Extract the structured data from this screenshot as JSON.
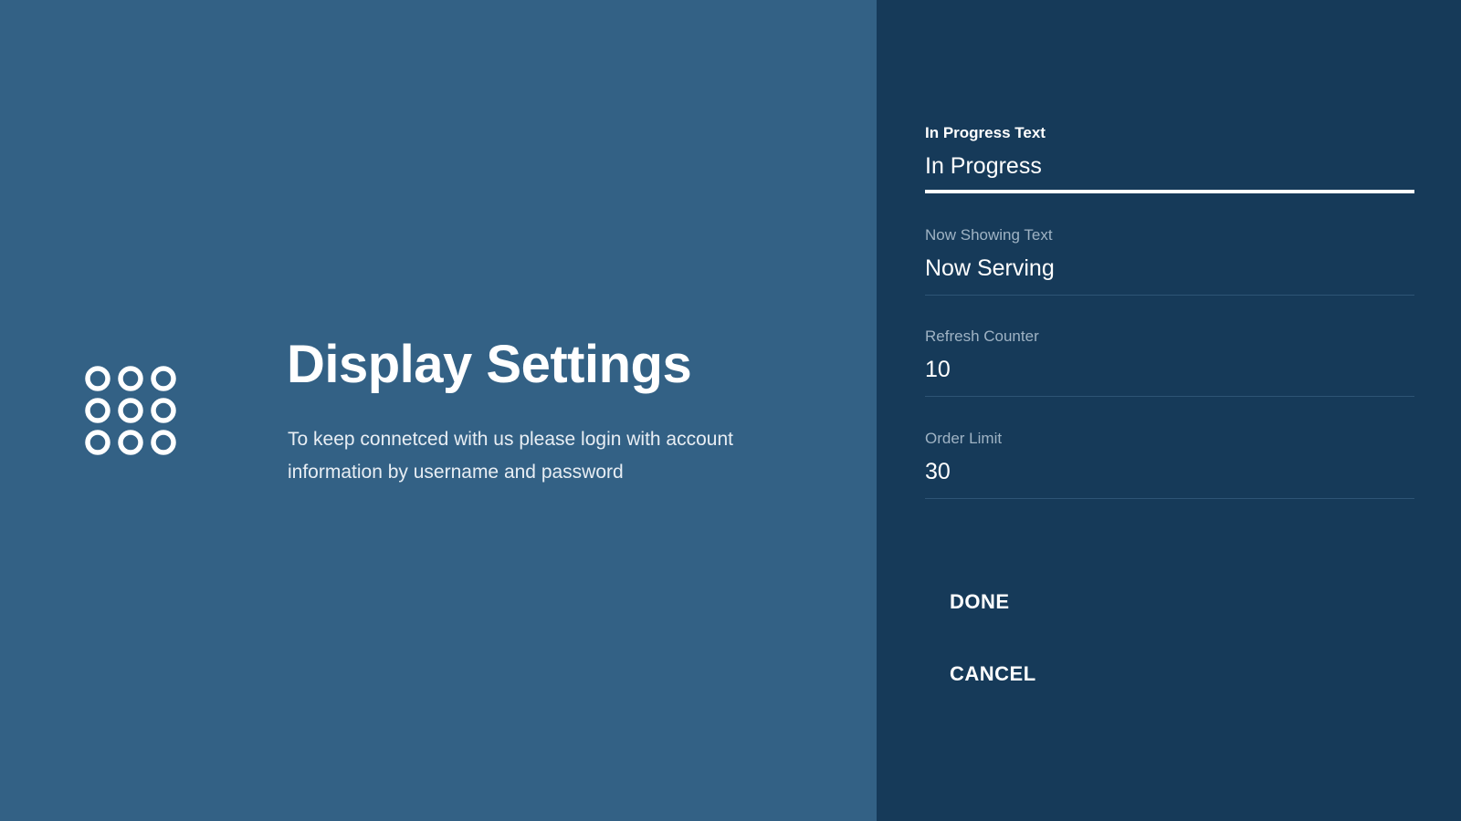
{
  "intro": {
    "icon": "dial-pad-icon",
    "title": "Display Settings",
    "description": "To keep connetced with us please login with account information by username and password"
  },
  "form": {
    "fields": [
      {
        "label": "In Progress Text",
        "value": "In Progress",
        "focused": true
      },
      {
        "label": "Now Showing Text",
        "value": "Now Serving",
        "focused": false
      },
      {
        "label": "Refresh Counter",
        "value": "10",
        "focused": false
      },
      {
        "label": "Order Limit",
        "value": "30",
        "focused": false
      }
    ],
    "done_label": "DONE",
    "cancel_label": "CANCEL"
  },
  "colors": {
    "left_background": "#336185",
    "right_background": "#163a59",
    "text": "#ffffff",
    "label_muted": "#9fb3c4"
  }
}
